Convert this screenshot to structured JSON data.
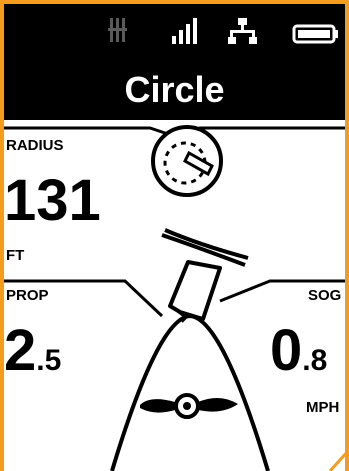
{
  "status_bar": {
    "icons": [
      "signal-bars-icon-dim",
      "signal-strength-icon",
      "network-icon",
      "battery-icon"
    ]
  },
  "header": {
    "title": "Circle"
  },
  "radius": {
    "label": "RADIUS",
    "value": "131",
    "unit": "FT"
  },
  "prop": {
    "label": "PROP",
    "value_int": "2",
    "value_dec": ".5"
  },
  "sog": {
    "label": "SOG",
    "value_int": "0",
    "value_dec": ".8",
    "unit": "MPH"
  },
  "colors": {
    "accent": "#f39c1f",
    "header_bg": "#000000",
    "text": "#000000"
  }
}
